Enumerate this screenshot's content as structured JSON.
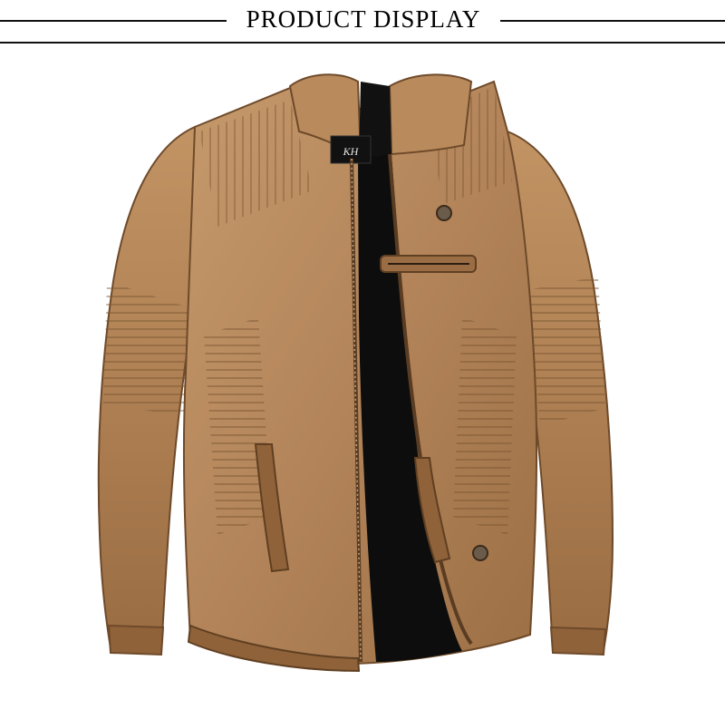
{
  "header": {
    "title": "PRODUCT DISPLAY"
  },
  "product_image": {
    "subject": "jacket-photo",
    "label_logo_text": "KH",
    "colors": {
      "leather": "#b8895c",
      "leather_dark": "#8c6238",
      "leather_light": "#cda273",
      "lining": "#0d0d0d",
      "background": "#ffffff"
    }
  }
}
